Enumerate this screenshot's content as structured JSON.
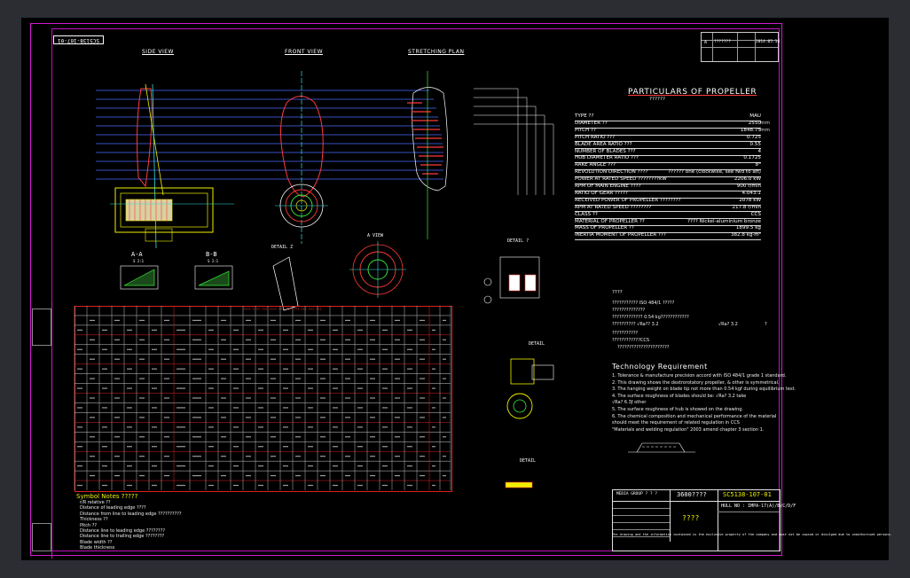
{
  "drawing": {
    "number_top_left": "SC5138-107-01",
    "view_labels": {
      "side_view": "SIDE VIEW",
      "front_view": "FRONT VIEW",
      "stretching_plan": "STRETCHING PLAN",
      "section_aa": "A-A",
      "section_aa_scale": "S 2:1",
      "section_bb": "B-B",
      "section_bb_scale": "S 2:1",
      "detail_z": "DETAIL Z",
      "a_view": "A VIEW",
      "detail_1": "DETAIL ?",
      "detail_2": "DETAIL",
      "detail_3": "DETAIL"
    }
  },
  "revision_table": {
    "rows": [
      [
        "",
        "",
        "",
        ""
      ],
      [
        "A",
        "???????",
        "",
        "2014.05.14"
      ]
    ]
  },
  "particulars": {
    "title": "PARTICULARS OF PROPELLER",
    "subtitle": "??????",
    "rows": [
      {
        "label": "TYPE ??",
        "value": "MAU"
      },
      {
        "label": "DIAMETER ??",
        "value": "2550",
        "unit": "mm"
      },
      {
        "label": "PITCH ??",
        "value": "1848.75",
        "unit": "mm"
      },
      {
        "label": "PITCH RATIO ???",
        "value": "0.725"
      },
      {
        "label": "BLADE AREA RATIO ???",
        "value": "0.55"
      },
      {
        "label": "NUMBER OF BLADES ???",
        "value": "4"
      },
      {
        "label": "HUB DIAMETER RATIO ???",
        "value": "0.1725"
      },
      {
        "label": "RAKE ANGLE ???",
        "value": "8°"
      },
      {
        "label": "REVOLUTION DIRECTION ????",
        "value": "?????? one (clockwise, see fwd to aft)"
      },
      {
        "label": "POWER AT RATED SPEED ????????kW",
        "value": "2206.0 kW"
      },
      {
        "label": "RPM OF MAIN ENGINE ????",
        "value": "900 r/min"
      },
      {
        "label": "RATIO OF GEAR ?????",
        "value": "4.043:1"
      },
      {
        "label": "RECEIVED POWER OF PROPELLER ????????",
        "value": "2078 kW"
      },
      {
        "label": "RPM AT RATED SPEED ????????",
        "value": "217.8 r/min"
      },
      {
        "label": "CLASS ??",
        "value": "CCS"
      },
      {
        "label": "MATERIAL OF PROPELLER ??",
        "value": "???? Nickel-aluminium bronze"
      },
      {
        "label": "MASS OF PROPELLER ??",
        "value": "1899.5 kg"
      },
      {
        "label": "INERTIA MOMENT OF PROPELLER ???",
        "value": "382.8 kg·m²"
      }
    ]
  },
  "notes_block": {
    "heading": "????",
    "lines": [
      "??????????? ISO 484/1 ?????",
      "??????????????",
      "????????????? 0.54 kg????????????",
      "?????????? √Ra?? 3.2",
      "???????????",
      "????????????CCS",
      "??????????????????????"
    ],
    "roughness_label": "√Ra? 3.2",
    "roughness_mark": "?"
  },
  "tech_requirement": {
    "title": "Technology Requirement",
    "items": [
      "1. Tolerance & manufacture precision accord with ISO 484/1 grade 1 standard.",
      "2. This drawing shows the dextrorotatory propeller, & other is symmetrical.",
      "3. The hanging weight on blade tip not more than 0.54 kgf during equilibrium test.",
      "4. The surface roughness of blades should be: √Ra? 3.2 take",
      "   √Ra? 6.3ƒ other",
      "5. The surface roughness of hub is showed on the drawing.",
      "6. The chemical composition and mechanical performance of the material",
      "   should meet the requirement of related regulation in CCS",
      "   \"Materials and welding regulation\" 2003 amend chapter 3 section 1."
    ]
  },
  "symbol_notes": {
    "title": "Symbol Notes ?????",
    "lines": [
      "r/R relative ??",
      "Distance of leading edge ????",
      "Distance from line to leading edge ??????????",
      "Thickness ??",
      "Pitch ??",
      "Distance line to leading edge ????????",
      "Distance line to trailing edge ????????",
      "Blade width ??",
      "Blade thickness"
    ]
  },
  "title_block": {
    "cell_company": "MEDIA GROUP ? ? ?",
    "cell_name": "3600????",
    "drawing_no": "SC5138-107-01",
    "part_name": "????",
    "hull_no": "HULL NO : IMPA-17(A)/B/C/D/F",
    "footer_line": "The drawing and the information contained is the exclusive property of the company and must not be copied or divulged due to unauthorised persons."
  },
  "table": {
    "header_label": "???? ???? ??? ???? ??? ??? ??? ??? ??? ???",
    "row_count": 19
  }
}
